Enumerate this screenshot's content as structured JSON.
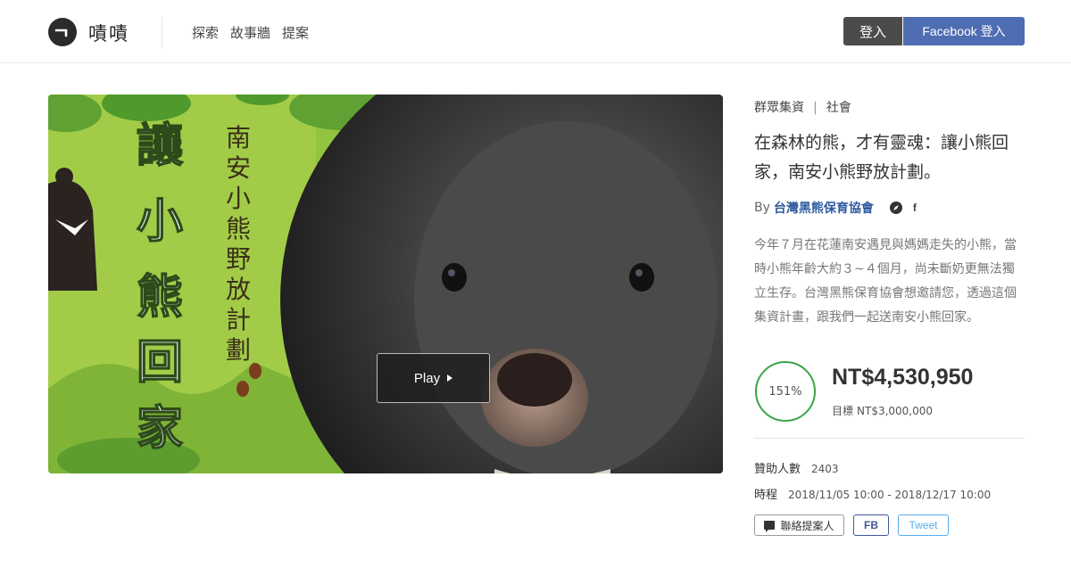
{
  "header": {
    "logo_text": "嘖嘖",
    "nav": [
      "探索",
      "故事牆",
      "提案"
    ],
    "login_label": "登入",
    "fb_login_label": "Facebook 登入"
  },
  "hero": {
    "play_label": "Play",
    "poster_title": "讓小熊回家",
    "poster_subtitle": "南安小熊野放計劃"
  },
  "project": {
    "category": "群眾集資",
    "tag": "社會",
    "title": "在森林的熊，才有靈魂：讓小熊回家，南安小熊野放計劃。",
    "by_prefix": "By",
    "org": "台灣黑熊保育協會",
    "description": "今年７月在花蓮南安遇見與媽媽走失的小熊，當時小熊年齡大約３~４個月，尚未斷奶更無法獨立生存。台灣黑熊保育協會想邀請您，透過這個集資計畫，跟我們一起送南安小熊回家。",
    "progress_percent": 151,
    "progress_label": "151%",
    "amount": "NT$4,530,950",
    "goal_label": "目標",
    "goal_value": "NT$3,000,000",
    "backers_label": "贊助人數",
    "backers_value": "2403",
    "period_label": "時程",
    "period_value": "2018/11/05 10:00 - 2018/12/17 10:00",
    "contact_label": "聯絡提案人",
    "fb_share_label": "FB",
    "tweet_label": "Tweet"
  },
  "colors": {
    "accent_green": "#3aa548",
    "facebook_blue": "#4e6db3",
    "org_link": "#2e5a9e",
    "tweet_blue": "#55acee"
  },
  "icons": [
    "logo-mark-icon",
    "compass-icon",
    "facebook-icon",
    "chat-icon",
    "play-icon"
  ]
}
